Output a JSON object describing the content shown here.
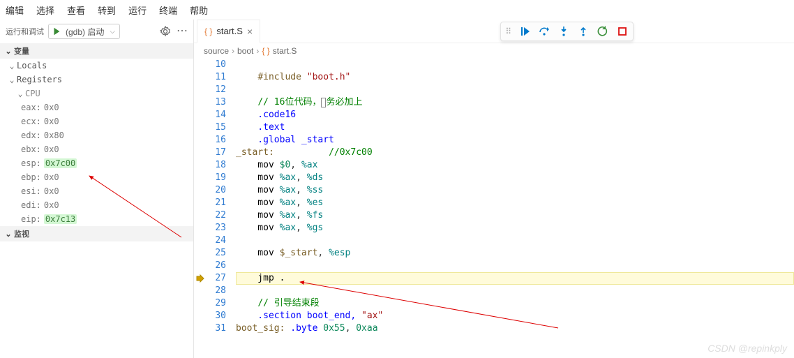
{
  "menu": [
    "编辑",
    "选择",
    "查看",
    "转到",
    "运行",
    "终端",
    "帮助"
  ],
  "sidebar": {
    "toolbar_label": "运行和调试",
    "launch_name": "(gdb) 启动",
    "sections": {
      "variables": {
        "title": "变量"
      },
      "locals": {
        "title": "Locals"
      },
      "registers": {
        "title": "Registers",
        "group": "CPU",
        "regs": [
          {
            "name": "eax",
            "val": "0x0",
            "hl": false
          },
          {
            "name": "ecx",
            "val": "0x0",
            "hl": false
          },
          {
            "name": "edx",
            "val": "0x80",
            "hl": false
          },
          {
            "name": "ebx",
            "val": "0x0",
            "hl": false
          },
          {
            "name": "esp",
            "val": "0x7c00",
            "hl": true
          },
          {
            "name": "ebp",
            "val": "0x0",
            "hl": false
          },
          {
            "name": "esi",
            "val": "0x0",
            "hl": false
          },
          {
            "name": "edi",
            "val": "0x0",
            "hl": false
          },
          {
            "name": "eip",
            "val": "0x7c13",
            "hl": true
          }
        ]
      },
      "watch": {
        "title": "监视"
      }
    }
  },
  "tab": {
    "filename": "start.S"
  },
  "breadcrumbs": [
    "source",
    "boot",
    "start.S"
  ],
  "code": {
    "first_line_no": 10,
    "current_exec_line_index": 17,
    "lines": [
      {
        "g": "10",
        "raw": ""
      },
      {
        "g": "11",
        "segs": [
          [
            "    ",
            ""
          ],
          [
            "#include ",
            "s-dir"
          ],
          [
            "\"boot.h\"",
            "s-str"
          ]
        ]
      },
      {
        "g": "12",
        "raw": ""
      },
      {
        "g": "13",
        "segs": [
          [
            "    ",
            ""
          ],
          [
            "// 16位代码，",
            "s-comm"
          ],
          [
            "CURSORBOX",
            ""
          ],
          [
            "务必加上",
            "s-comm"
          ]
        ]
      },
      {
        "g": "14",
        "segs": [
          [
            "    .code16",
            "s-kw"
          ]
        ]
      },
      {
        "g": "15",
        "segs": [
          [
            "    .text",
            "s-kw"
          ]
        ]
      },
      {
        "g": "16",
        "segs": [
          [
            "    .global _start",
            "s-kw"
          ]
        ]
      },
      {
        "g": "17",
        "segs": [
          [
            "_start:",
            "s-lab"
          ],
          [
            "          ",
            ""
          ],
          [
            "//0x7c00",
            "s-comm"
          ]
        ]
      },
      {
        "g": "18",
        "segs": [
          [
            "    mov ",
            "s-def"
          ],
          [
            "$0",
            "s-num"
          ],
          [
            ", ",
            ""
          ],
          [
            "%ax",
            "s-reg"
          ]
        ]
      },
      {
        "g": "19",
        "segs": [
          [
            "    mov ",
            "s-def"
          ],
          [
            "%ax",
            "s-reg"
          ],
          [
            ", ",
            ""
          ],
          [
            "%ds",
            "s-reg"
          ]
        ]
      },
      {
        "g": "20",
        "segs": [
          [
            "    mov ",
            "s-def"
          ],
          [
            "%ax",
            "s-reg"
          ],
          [
            ", ",
            ""
          ],
          [
            "%ss",
            "s-reg"
          ]
        ]
      },
      {
        "g": "21",
        "segs": [
          [
            "    mov ",
            "s-def"
          ],
          [
            "%ax",
            "s-reg"
          ],
          [
            ", ",
            ""
          ],
          [
            "%es",
            "s-reg"
          ]
        ]
      },
      {
        "g": "22",
        "segs": [
          [
            "    mov ",
            "s-def"
          ],
          [
            "%ax",
            "s-reg"
          ],
          [
            ", ",
            ""
          ],
          [
            "%fs",
            "s-reg"
          ]
        ]
      },
      {
        "g": "23",
        "segs": [
          [
            "    mov ",
            "s-def"
          ],
          [
            "%ax",
            "s-reg"
          ],
          [
            ", ",
            ""
          ],
          [
            "%gs",
            "s-reg"
          ]
        ]
      },
      {
        "g": "24",
        "raw": ""
      },
      {
        "g": "25",
        "segs": [
          [
            "    mov ",
            "s-def"
          ],
          [
            "$_start",
            "s-lab"
          ],
          [
            ", ",
            ""
          ],
          [
            "%esp",
            "s-reg"
          ]
        ]
      },
      {
        "g": "26",
        "raw": ""
      },
      {
        "g": "27",
        "segs": [
          [
            "    jmp ",
            "s-def"
          ],
          [
            ".",
            "s-def"
          ]
        ],
        "exec": true
      },
      {
        "g": "28",
        "raw": ""
      },
      {
        "g": "29",
        "segs": [
          [
            "    ",
            ""
          ],
          [
            "// 引导结束段",
            "s-comm"
          ]
        ]
      },
      {
        "g": "30",
        "segs": [
          [
            "    .section boot_end, ",
            "s-kw"
          ],
          [
            "\"ax\"",
            "s-str"
          ]
        ]
      },
      {
        "g": "31",
        "segs": [
          [
            "boot_sig: ",
            "s-lab"
          ],
          [
            ".byte ",
            "s-kw"
          ],
          [
            "0x55",
            "s-num"
          ],
          [
            ", ",
            ""
          ],
          [
            "0xaa",
            "s-num"
          ]
        ]
      }
    ]
  },
  "watermark": "CSDN @repinkply"
}
